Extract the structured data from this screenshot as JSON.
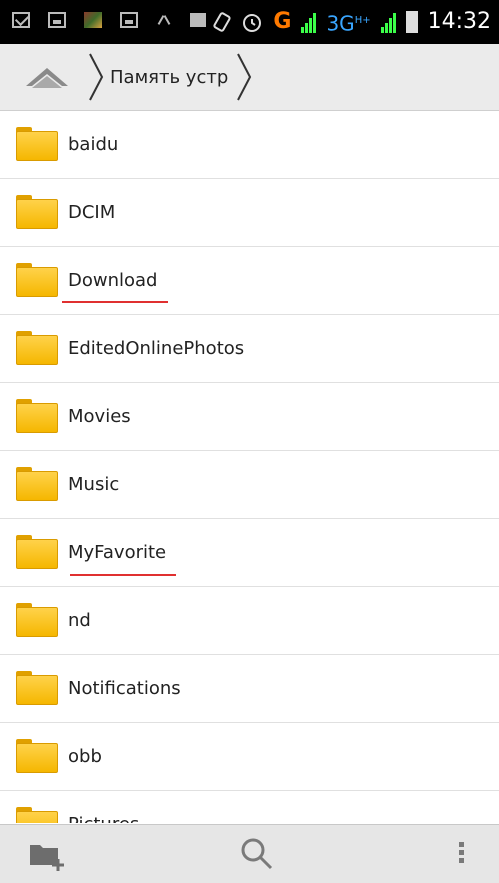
{
  "status_bar": {
    "network": "G",
    "network_type": "3G",
    "network_sup": "H+",
    "time": "14:32"
  },
  "path_bar": {
    "current_location": "Память устр"
  },
  "folders": [
    {
      "name": "baidu"
    },
    {
      "name": "DCIM"
    },
    {
      "name": "Download"
    },
    {
      "name": "EditedOnlinePhotos"
    },
    {
      "name": "Movies"
    },
    {
      "name": "Music"
    },
    {
      "name": "MyFavorite"
    },
    {
      "name": "nd"
    },
    {
      "name": "Notifications"
    },
    {
      "name": "obb"
    },
    {
      "name": "Pictures"
    }
  ],
  "bottom_bar": {
    "icons": [
      "new-folder-icon",
      "search-icon",
      "overflow-menu-icon"
    ]
  },
  "colors": {
    "folder": "#f5b700",
    "underline": "#e03030",
    "signal": "#3cff4a",
    "network_3g": "#3aa6ff"
  }
}
